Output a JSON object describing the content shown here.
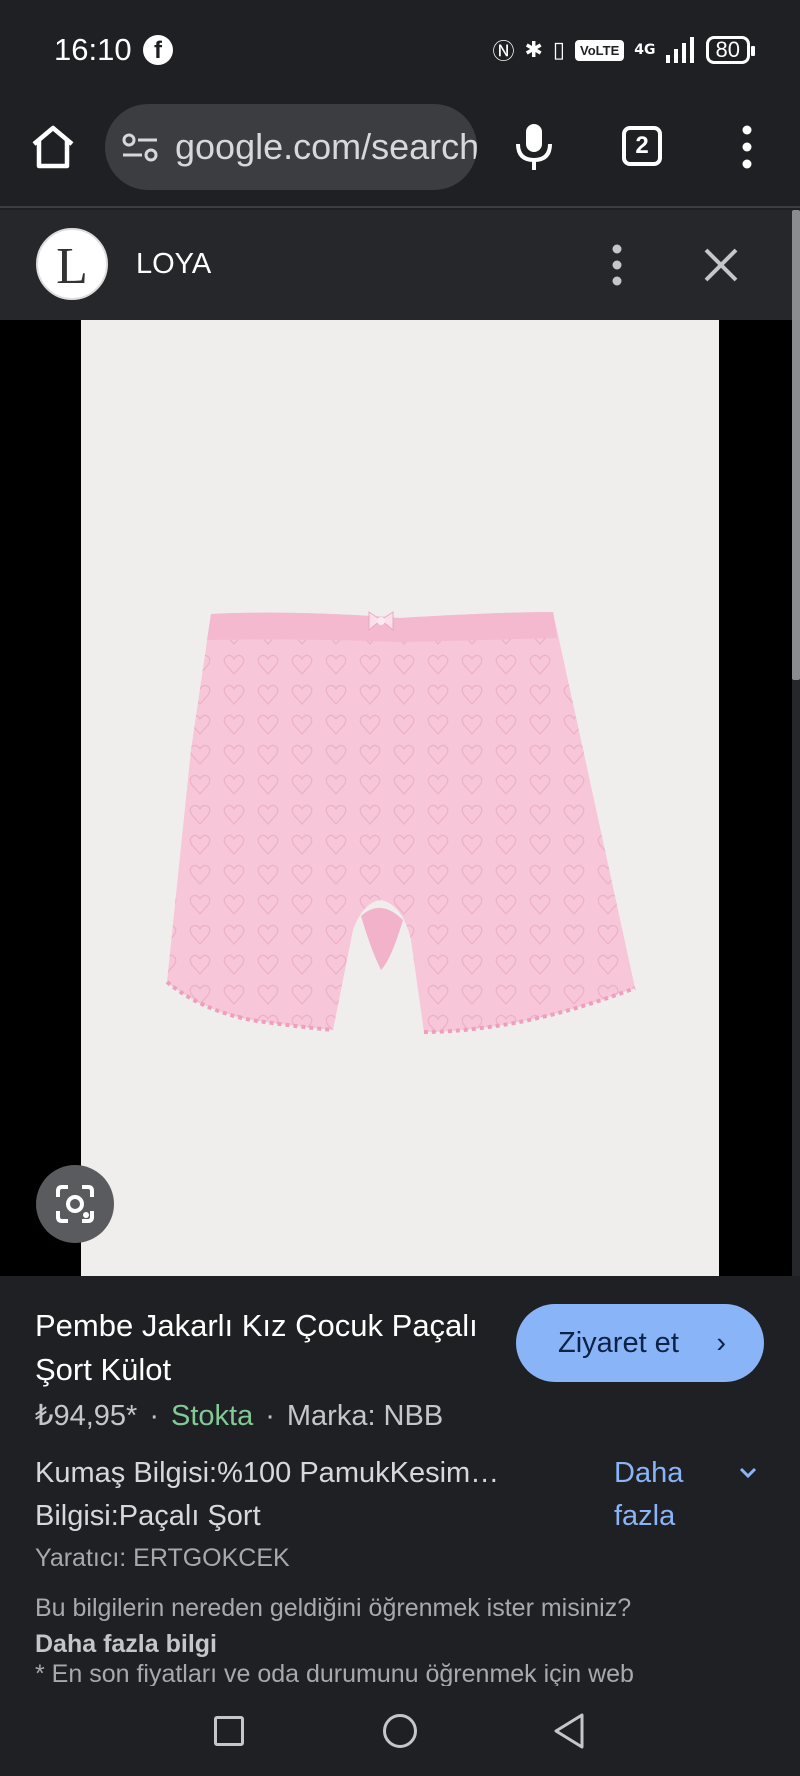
{
  "status_bar": {
    "time": "16:10",
    "app_icon": "facebook-icon",
    "volte": "VoLTE",
    "network": "4G",
    "battery": "80"
  },
  "browser": {
    "url": "google.com/search",
    "tab_count": "2"
  },
  "source": {
    "logo_letter": "L",
    "name": "LOYA"
  },
  "product": {
    "title": "Pembe Jakarlı Kız Çocuk Paçalı Şort Külot",
    "visit_label": "Ziyaret et",
    "price": "₺94,95*",
    "stock": "Stokta",
    "brand": "Marka: NBB",
    "description": "Kumaş Bilgisi:%100 PamukKesim… Bilgisi:Paçalı Şort",
    "more_label": "Daha fazla",
    "creator": "Yaratıcı: ERTGOKCEK",
    "source_question": "Bu bilgilerin nereden geldiğini öğrenmek ister misiniz?",
    "source_link": "Daha fazla bilgi",
    "footnote": "* En son fiyatları ve oda durumunu öğrenmek için web"
  },
  "colors": {
    "accent": "#8ab4f8",
    "stock_green": "#81c995",
    "product_pink": "#f7c6d9"
  }
}
